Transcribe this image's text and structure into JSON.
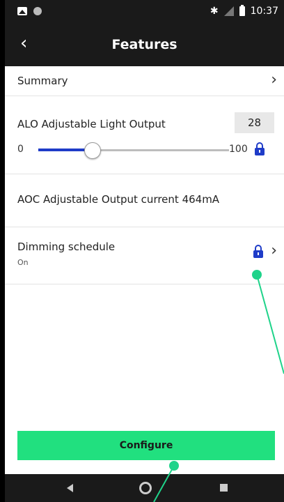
{
  "status_bar": {
    "time": "10:37",
    "bluetooth_glyph": "✱"
  },
  "app_bar": {
    "back_glyph": "‹",
    "title": "Features"
  },
  "summary": {
    "label": "Summary",
    "chevron": "›"
  },
  "alo": {
    "label": "ALO Adjustable Light Output",
    "value": "28",
    "min_label": "0",
    "max_label": "100",
    "slider_fraction": 0.28,
    "locked": true
  },
  "aoc": {
    "label": "AOC Adjustable Output current 464mA"
  },
  "dimming": {
    "label": "Dimming schedule",
    "status": "On",
    "chevron": "›",
    "locked": true
  },
  "configure": {
    "label": "Configure"
  },
  "colors": {
    "accent_blue": "#1f3cc8",
    "configure_green": "#21e07f",
    "annotation_green": "#1fd38a",
    "app_bar": "#1a1a1a"
  },
  "icons": {
    "back": "back-arrow-icon",
    "chevron": "chevron-right-icon",
    "lock": "lock-icon",
    "nav_back": "nav-back-icon",
    "nav_home": "nav-home-icon",
    "nav_recents": "nav-recents-icon"
  }
}
